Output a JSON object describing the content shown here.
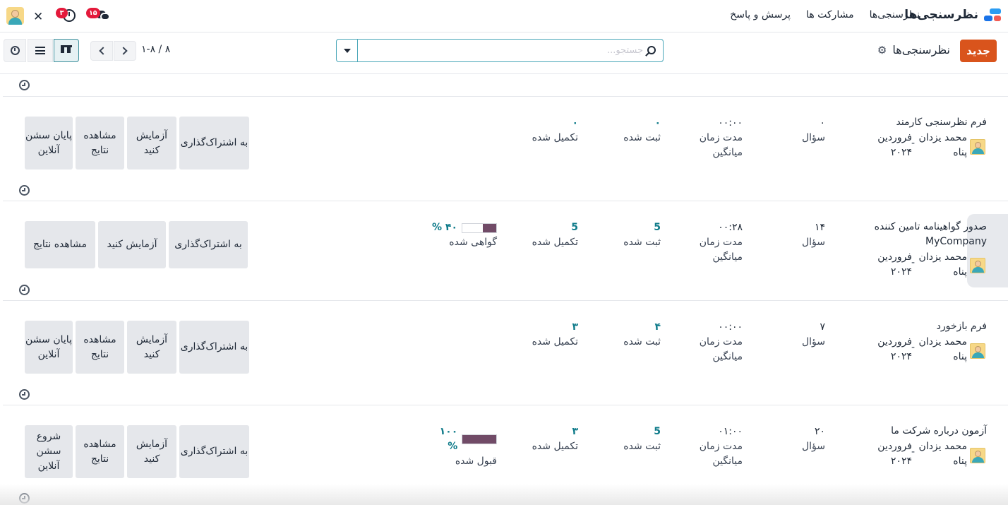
{
  "navbar": {
    "app_name": "نظرسنجی‌ها",
    "menu": [
      "نظرسنجی‌ها",
      "مشارکت ها",
      "پرسش و پاسخ"
    ],
    "chat_badge": "۱۵",
    "activity_badge": "۳"
  },
  "control": {
    "new_label": "جدید",
    "breadcrumb": "نظرسنجی‌ها",
    "search_placeholder": "جستجو...",
    "pager": "۱-۸ / ۸"
  },
  "colors": {
    "accent": "#d9541c",
    "teal": "#0f7b8a",
    "bar_fill": "#714b67"
  },
  "cards": [
    {
      "title": "فرم نظرسنجی کارمند",
      "title2": "",
      "owner": "محمد یزدان پناه",
      "date": "فروردین ۲۰۲۴",
      "dash": "-",
      "questions": {
        "value": "۰",
        "label": "سؤال"
      },
      "duration": {
        "value": "۰۰:۰۰",
        "label": "مدت زمان میانگین"
      },
      "registered": {
        "value": "۰",
        "label": "ثبت شده"
      },
      "completed": {
        "value": "۰",
        "label": "تکمیل شده"
      },
      "buttons": [
        "به اشتراک‌گذاری",
        "آزمایش کنید",
        "مشاهده نتایج",
        "پایان سشن آنلاین"
      ]
    },
    {
      "title": "صدور گواهینامه تامین کننده",
      "title2": "MyCompany",
      "owner": "محمد یزدان پناه",
      "date": "فروردین ۲۰۲۴",
      "dash": "-",
      "questions": {
        "value": "۱۴",
        "label": "سؤال"
      },
      "duration": {
        "value": "۰۰:۲۸",
        "label": "مدت زمان میانگین"
      },
      "registered": {
        "value": "5",
        "label": "ثبت شده"
      },
      "completed": {
        "value": "5",
        "label": "تکمیل شده"
      },
      "progress": {
        "percent": 40,
        "text": "۴۰ %",
        "label": "گواهی شده"
      },
      "buttons": [
        "به اشتراک‌گذاری",
        "آزمایش کنید",
        "مشاهده نتایج"
      ]
    },
    {
      "title": "فرم بازخورد",
      "title2": "",
      "owner": "محمد یزدان پناه",
      "date": "فروردین ۲۰۲۴",
      "dash": "-",
      "questions": {
        "value": "۷",
        "label": "سؤال"
      },
      "duration": {
        "value": "۰۰:۰۰",
        "label": "مدت زمان میانگین"
      },
      "registered": {
        "value": "۴",
        "label": "ثبت شده"
      },
      "completed": {
        "value": "۳",
        "label": "تکمیل شده"
      },
      "buttons": [
        "به اشتراک‌گذاری",
        "آزمایش کنید",
        "مشاهده نتایج",
        "پایان سشن آنلاین"
      ]
    },
    {
      "title": "آزمون درباره شرکت ما",
      "title2": "",
      "owner": "محمد یزدان پناه",
      "date": "فروردین ۲۰۲۴",
      "dash": "-",
      "questions": {
        "value": "۲۰",
        "label": "سؤال"
      },
      "duration": {
        "value": "۰۱:۰۰",
        "label": "مدت زمان میانگین"
      },
      "registered": {
        "value": "5",
        "label": "ثبت شده"
      },
      "completed": {
        "value": "۳",
        "label": "تکمیل شده"
      },
      "progress": {
        "percent": 100,
        "text": "۱۰۰ %",
        "label": "قبول شده"
      },
      "buttons": [
        "به اشتراک‌گذاری",
        "آزمایش کنید",
        "مشاهده نتایج",
        "شروع سشن آنلاین"
      ]
    }
  ]
}
